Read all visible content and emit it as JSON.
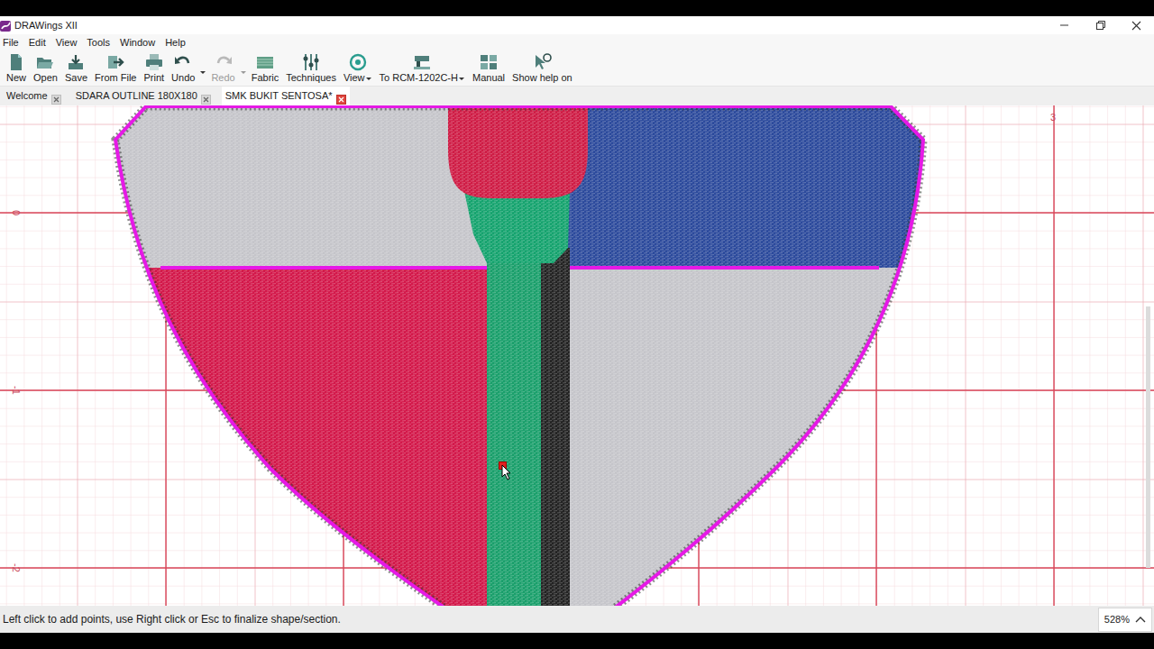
{
  "window": {
    "title": "DRAWings XII"
  },
  "menu": [
    "File",
    "Edit",
    "View",
    "Tools",
    "Window",
    "Help"
  ],
  "toolbar": [
    {
      "label": "New",
      "disabled": false,
      "kind": "plain"
    },
    {
      "label": "Open",
      "disabled": false,
      "kind": "plain"
    },
    {
      "label": "Save",
      "disabled": false,
      "kind": "plain"
    },
    {
      "label": "From File",
      "disabled": false,
      "kind": "plain"
    },
    {
      "label": "Print",
      "disabled": false,
      "kind": "plain"
    },
    {
      "label": "Undo",
      "disabled": false,
      "kind": "split"
    },
    {
      "label": "Redo",
      "disabled": true,
      "kind": "split"
    },
    {
      "label": "Fabric",
      "disabled": false,
      "kind": "plain"
    },
    {
      "label": "Techniques",
      "disabled": false,
      "kind": "plain"
    },
    {
      "label": "View",
      "disabled": false,
      "kind": "menu"
    },
    {
      "label": "To RCM-1202C-H",
      "disabled": false,
      "kind": "menu"
    },
    {
      "label": "Manual",
      "disabled": false,
      "kind": "plain"
    },
    {
      "label": "Show help on",
      "disabled": false,
      "kind": "plain"
    }
  ],
  "tabs": [
    {
      "label": "Welcome",
      "selected": false
    },
    {
      "label": "SDARA OUTLINE 180X180",
      "selected": false
    },
    {
      "label": "SMK BUKIT SENTOSA*",
      "selected": true
    }
  ],
  "canvas": {
    "ruler_labels": [
      "0",
      "-1",
      "-2",
      "3"
    ]
  },
  "status_bar": {
    "hint": "Left click to add points, use Right click or Esc to finalize shape/section.",
    "zoom": "528%"
  }
}
